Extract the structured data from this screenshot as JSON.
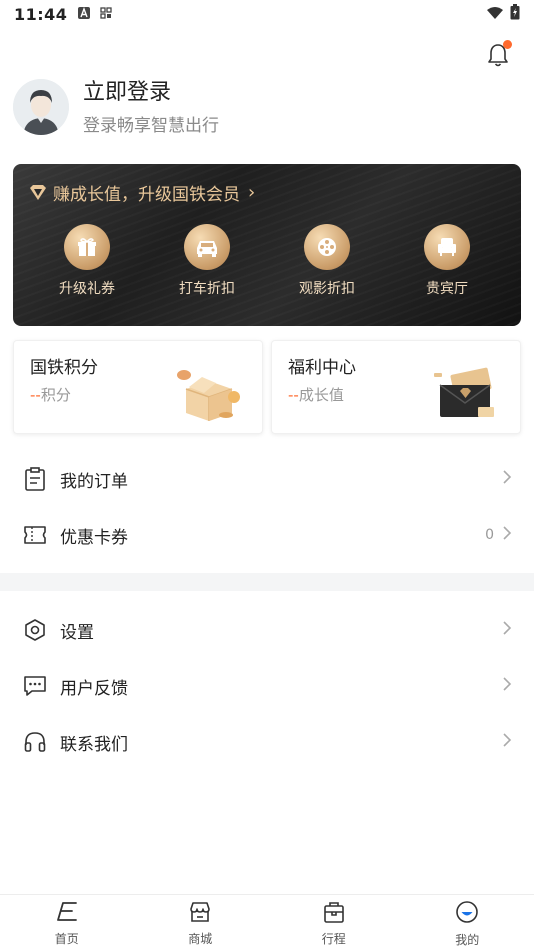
{
  "status_bar": {
    "time": "11:44"
  },
  "profile": {
    "title": "立即登录",
    "subtitle": "登录畅享智慧出行"
  },
  "member": {
    "headline": "赚成长值，升级国铁会员",
    "perks": [
      {
        "label": "升级礼券",
        "icon": "gift-icon"
      },
      {
        "label": "打车折扣",
        "icon": "car-icon"
      },
      {
        "label": "观影折扣",
        "icon": "film-reel-icon"
      },
      {
        "label": "贵宾厅",
        "icon": "armchair-icon"
      }
    ],
    "accent": "#e9c79a"
  },
  "cards": [
    {
      "title": "国铁积分",
      "prefix": "--",
      "unit": "积分"
    },
    {
      "title": "福利中心",
      "prefix": "--",
      "unit": "成长值"
    }
  ],
  "list1": [
    {
      "label": "我的订单",
      "icon": "clipboard-icon",
      "value": ""
    },
    {
      "label": "优惠卡券",
      "icon": "coupon-icon",
      "value": "0"
    }
  ],
  "list2": [
    {
      "label": "设置",
      "icon": "hexagon-settings-icon"
    },
    {
      "label": "用户反馈",
      "icon": "chat-bubble-icon"
    },
    {
      "label": "联系我们",
      "icon": "headphones-icon"
    }
  ],
  "tabs": [
    {
      "label": "首页",
      "icon": "home-icon"
    },
    {
      "label": "商城",
      "icon": "shop-icon"
    },
    {
      "label": "行程",
      "icon": "trip-icon"
    },
    {
      "label": "我的",
      "icon": "profile-icon"
    }
  ]
}
